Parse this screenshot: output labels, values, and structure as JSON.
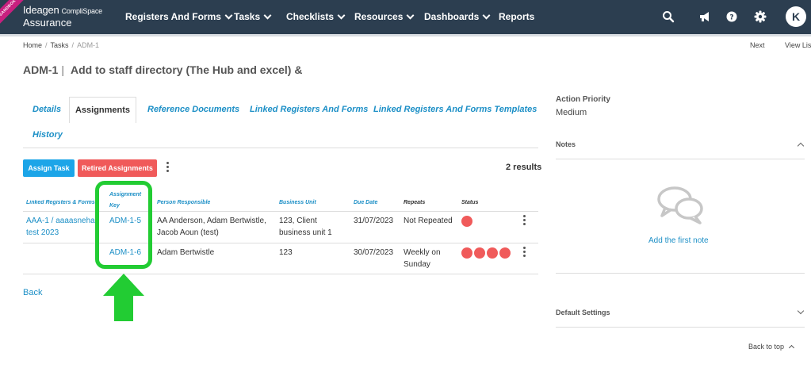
{
  "app": {
    "ribbon_text": "SANDBOX",
    "logo_brand": "Ideagen",
    "logo_sub": "CompliSpace",
    "logo_product": "Assurance",
    "user_initial": "K"
  },
  "nav": {
    "items": [
      "Registers And Forms",
      "Tasks",
      "Checklists",
      "Resources",
      "Dashboards",
      "Reports"
    ]
  },
  "breadcrumb": {
    "home": "Home",
    "tasks": "Tasks",
    "current": "ADM-1"
  },
  "pager": {
    "next": "Next",
    "view_list": "View List"
  },
  "title": {
    "key": "ADM-1",
    "separator": "|",
    "text": "Add to staff directory (The Hub and excel) &"
  },
  "tabs": {
    "details": "Details",
    "assignments": "Assignments",
    "reference_documents": "Reference Documents",
    "linked_registers": "Linked Registers And Forms",
    "linked_templates": "Linked Registers And Forms Templates",
    "history": "History"
  },
  "toolbar": {
    "assign_task": "Assign Task",
    "retired": "Retired Assignments",
    "results": "2 results"
  },
  "table": {
    "headers": {
      "linked": "Linked Registers & Forms",
      "key": "Assignment Key",
      "person": "Person Responsible",
      "unit": "Business Unit",
      "due": "Due Date",
      "repeats": "Repeats",
      "status": "Status"
    },
    "rows": [
      {
        "linked_line1": "AAA-1 / aaaasneha",
        "linked_line2": "test 2023",
        "key": "ADM-1-5",
        "person_line1": "AA Anderson, Adam Bertwistle,",
        "person_line2": "Jacob Aoun (test)",
        "unit_line1": "123, Client",
        "unit_line2": "business unit 1",
        "due": "31/07/2023",
        "repeats_line1": "Not Repeated",
        "repeats_line2": "",
        "status_count": 1
      },
      {
        "linked_line1": "",
        "linked_line2": "",
        "key": "ADM-1-6",
        "person_line1": "Adam Bertwistle",
        "person_line2": "",
        "unit_line1": "123",
        "unit_line2": "",
        "due": "30/07/2023",
        "repeats_line1": "Weekly on",
        "repeats_line2": "Sunday",
        "status_count": 4
      }
    ]
  },
  "back": "Back",
  "sidebar": {
    "priority_label": "Action Priority",
    "priority_value": "Medium",
    "notes_label": "Notes",
    "add_note": "Add the first note",
    "default_settings": "Default Settings",
    "back_to_top": "Back to top"
  },
  "colors": {
    "topbar": "#2c3e50",
    "link": "#1c8fc6",
    "assign_button": "#1ca5e8",
    "retired_button": "#f05a5a",
    "status_dot": "#f05a5a",
    "highlight": "#22cc33"
  }
}
